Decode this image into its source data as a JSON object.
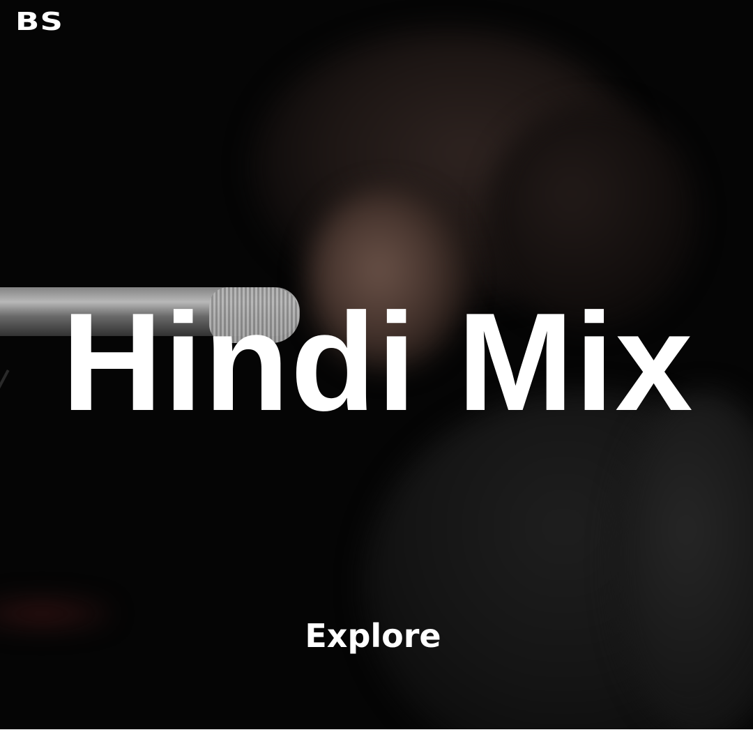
{
  "brand": {
    "logo_text": "BS"
  },
  "hero": {
    "title": "Hindi Mix",
    "cta_label": "Explore"
  },
  "colors": {
    "background": "#050505",
    "text": "#ffffff",
    "footer": "#ffffff"
  }
}
